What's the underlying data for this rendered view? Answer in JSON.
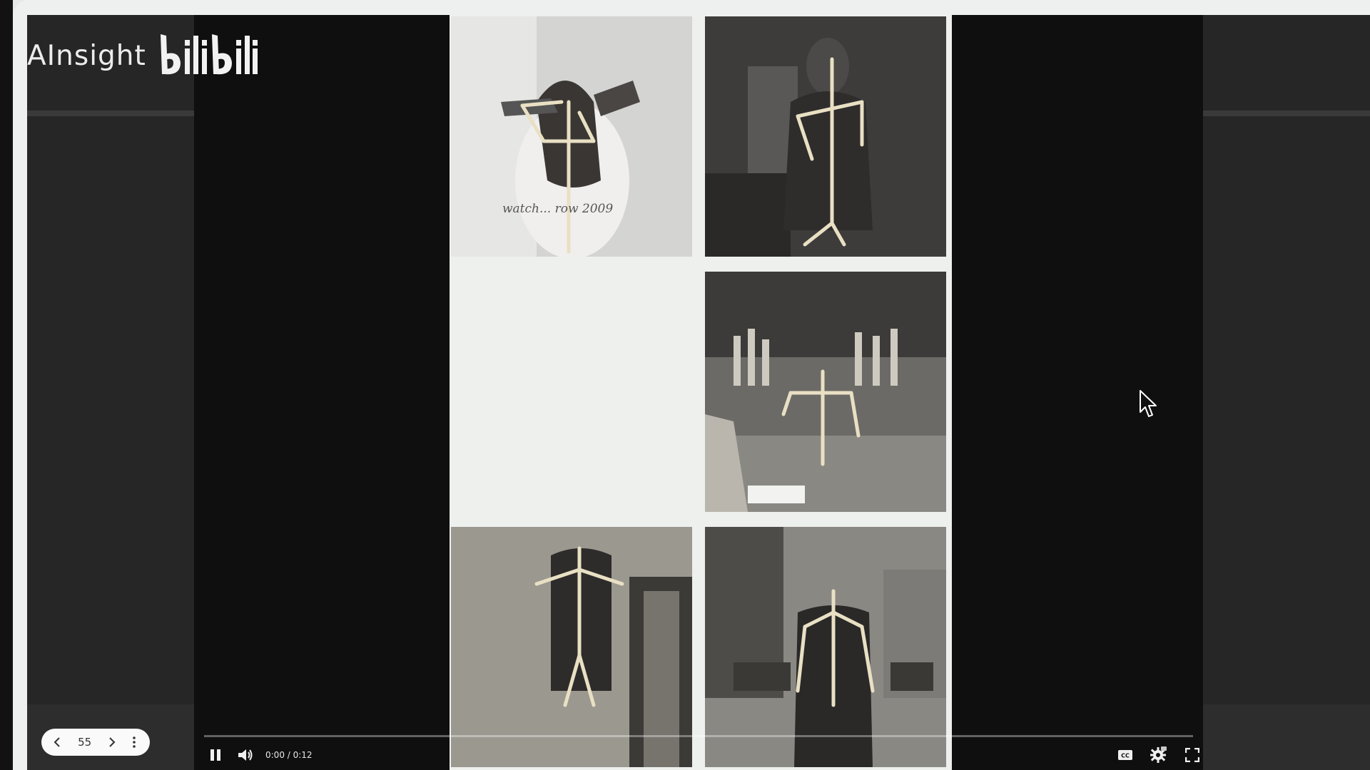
{
  "brand": {
    "name": "AInsight",
    "partner": "bilibili"
  },
  "pager": {
    "current": "55"
  },
  "player": {
    "time": "0:00 / 0:12",
    "state": "playing"
  },
  "video_frame": {
    "watermark": "watch... row 2009"
  },
  "icons": [
    "chevron-left-icon",
    "chevron-right-icon",
    "more-vertical-icon",
    "pause-icon",
    "volume-icon",
    "captions-icon",
    "settings-icon",
    "fullscreen-icon",
    "mouse-cursor-icon"
  ],
  "colors": {
    "panel": "#262626",
    "player": "#0f0f0f",
    "skeleton": "#e9e0c4"
  }
}
